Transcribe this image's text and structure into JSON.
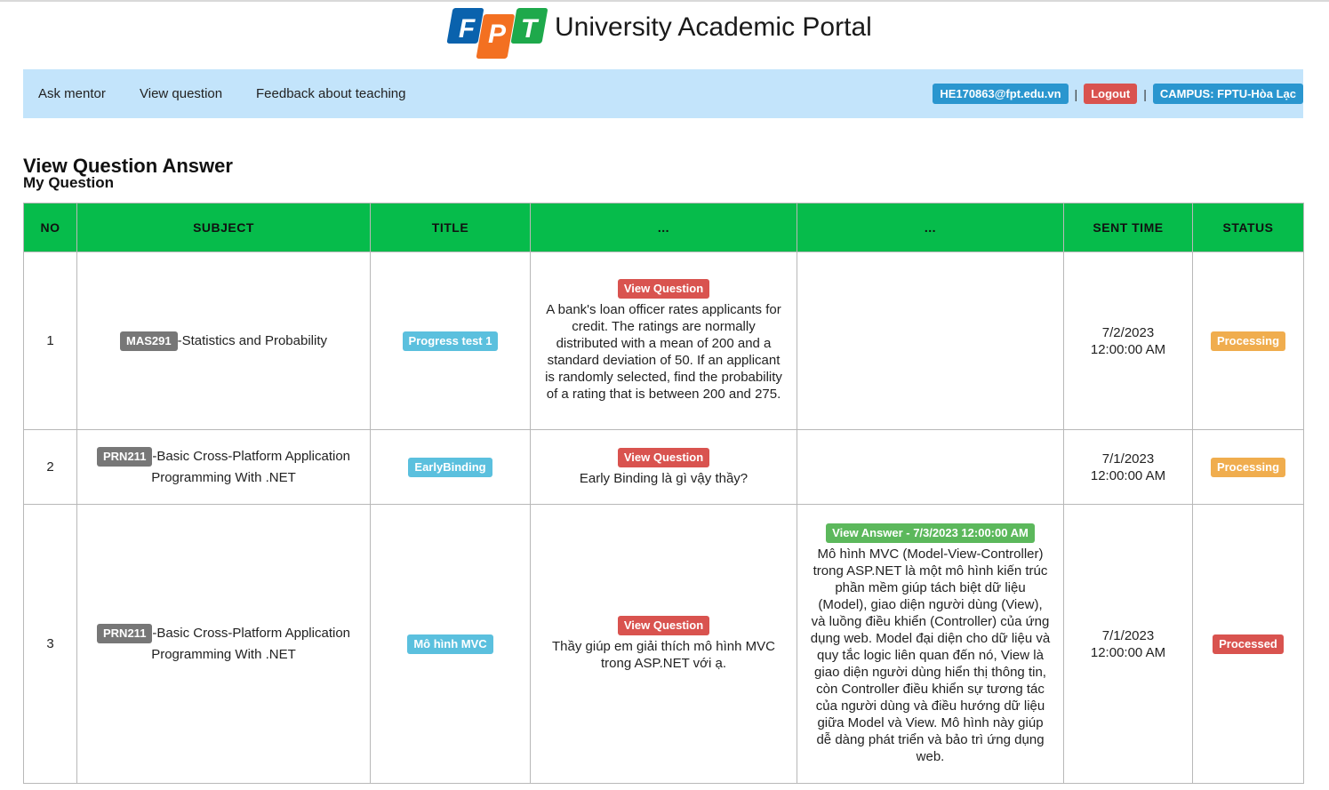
{
  "header": {
    "logo_letters": [
      "F",
      "P",
      "T"
    ],
    "portal_title": "University Academic Portal"
  },
  "nav": {
    "links": [
      "Ask mentor",
      "View question",
      "Feedback about teaching"
    ],
    "user_email": "HE170863@fpt.edu.vn",
    "separator": "|",
    "logout_label": "Logout",
    "campus_label": "CAMPUS: FPTU-Hòa Lạc"
  },
  "page": {
    "heading": "View Question Answer",
    "subheading": "My Question"
  },
  "table": {
    "columns": [
      "NO",
      "SUBJECT",
      "TITLE",
      "...",
      "...",
      "SENT TIME",
      "STATUS"
    ],
    "rows": [
      {
        "no": "1",
        "subject_code": "MAS291",
        "subject_name": "-Statistics and Probability",
        "title": "Progress test 1",
        "view_question_label": "View Question",
        "question_text": "A bank's loan officer rates applicants for credit. The ratings are normally distributed with a mean of 200 and a standard deviation of 50. If an applicant is randomly selected, find the probability of a rating that is between 200 and 275.",
        "view_answer_label": "",
        "answer_text": "",
        "sent_date": "7/2/2023",
        "sent_time": "12:00:00 AM",
        "status": "Processing"
      },
      {
        "no": "2",
        "subject_code": "PRN211",
        "subject_name": "-Basic Cross-Platform Application Programming With .NET",
        "title": "EarlyBinding",
        "view_question_label": "View Question",
        "question_text": "Early Binding là gì vậy thầy?",
        "view_answer_label": "",
        "answer_text": "",
        "sent_date": "7/1/2023",
        "sent_time": "12:00:00 AM",
        "status": "Processing"
      },
      {
        "no": "3",
        "subject_code": "PRN211",
        "subject_name": "-Basic Cross-Platform Application Programming With .NET",
        "title": "Mô hình MVC",
        "view_question_label": "View Question",
        "question_text": "Thầy giúp em giải thích mô hình MVC trong ASP.NET với ạ.",
        "view_answer_label": "View Answer - 7/3/2023 12:00:00 AM",
        "answer_text": "Mô hình MVC (Model-View-Controller) trong ASP.NET là một mô hình kiến trúc phần mềm giúp tách biệt dữ liệu (Model), giao diện người dùng (View), và luồng điều khiển (Controller) của ứng dụng web. Model đại diện cho dữ liệu và quy tắc logic liên quan đến nó, View là giao diện người dùng hiển thị thông tin, còn Controller điều khiển sự tương tác của người dùng và điều hướng dữ liệu giữa Model và View. Mô hình này giúp dễ dàng phát triển và bảo trì ứng dụng web.",
        "sent_date": "7/1/2023",
        "sent_time": "12:00:00 AM",
        "status": "Processed"
      }
    ]
  },
  "colors": {
    "navbar_bg": "#c3e4fb",
    "table_header_bg": "#06bc4b",
    "logo_blue": "#0a62ad",
    "logo_orange": "#f37021",
    "logo_green": "#1ea94b",
    "badge_gray": "#777777",
    "badge_info": "#5bc0de",
    "badge_red": "#d9534f",
    "badge_green": "#5cb85c",
    "badge_warning": "#f0ad4e"
  }
}
